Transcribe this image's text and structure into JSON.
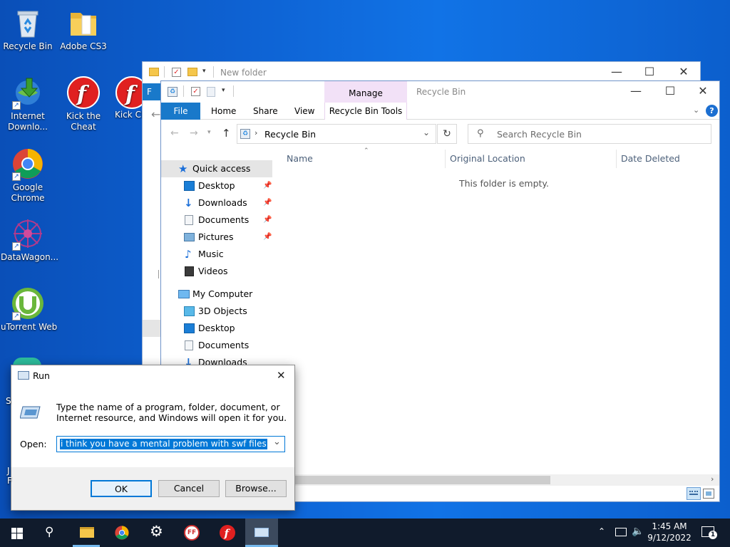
{
  "desktop": {
    "icons": [
      {
        "label": "Recycle Bin"
      },
      {
        "label": "Adobe CS3"
      },
      {
        "label": "Internet Downlo..."
      },
      {
        "label": "Kick the Cheat"
      },
      {
        "label": "Kick Cheat_..."
      },
      {
        "label": "Google Chrome"
      },
      {
        "label": "DataWagon..."
      },
      {
        "label": "uTorrent Web"
      }
    ]
  },
  "back_window": {
    "title": "New folder",
    "ribbon_file_partial": "F"
  },
  "explorer": {
    "title": "Recycle Bin",
    "context_tab_group": "Manage",
    "tabs": [
      "File",
      "Home",
      "Share",
      "View",
      "Recycle Bin Tools"
    ],
    "address": "Recycle Bin",
    "search_placeholder": "Search Recycle Bin",
    "columns": [
      "Name",
      "Original Location",
      "Date Deleted"
    ],
    "empty_message": "This folder is empty.",
    "nav": {
      "quick_access": "Quick access",
      "quick_items": [
        "Desktop",
        "Downloads",
        "Documents",
        "Pictures",
        "Music",
        "Videos"
      ],
      "my_computer": "My Computer",
      "computer_items": [
        "3D Objects",
        "Desktop",
        "Documents",
        "Downloads"
      ]
    }
  },
  "run_dialog": {
    "title": "Run",
    "description": "Type the name of a program, folder, document, or Internet resource, and Windows will open it for you.",
    "open_label": "Open:",
    "input_value": "i think you have a mental problem with swf files",
    "ok": "OK",
    "cancel": "Cancel",
    "browse": "Browse..."
  },
  "taskbar": {
    "time": "1:45 AM",
    "date": "9/12/2022",
    "notification_count": "1",
    "app_badge": "FF"
  },
  "colors": {
    "accent": "#1979ca",
    "manage_tab": "#f2e1f7",
    "taskbar": "#101b2c",
    "selection": "#0078d7"
  }
}
